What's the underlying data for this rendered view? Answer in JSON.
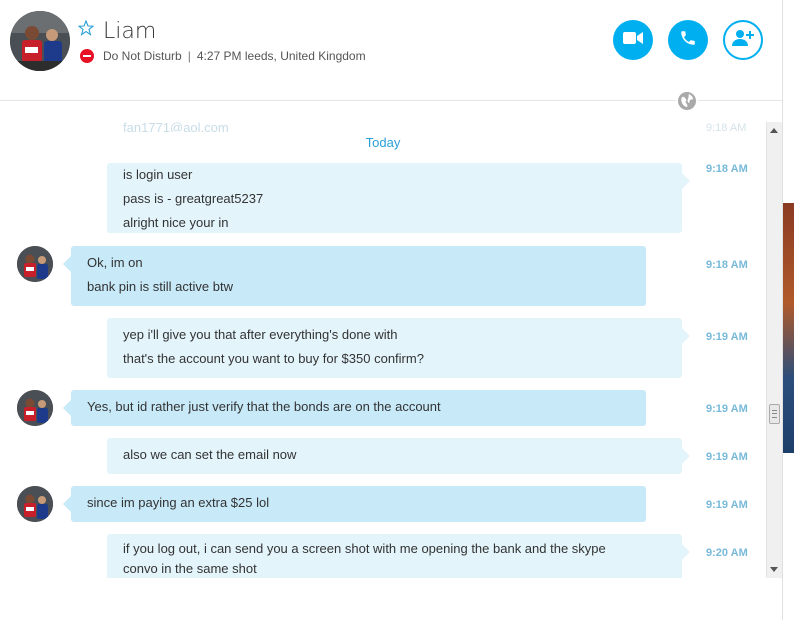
{
  "contact": {
    "name": "Liam",
    "status": "Do Not Disturb",
    "local_time": "4:27 PM leeds, United Kingdom",
    "separator": "|"
  },
  "icons": {
    "star": "star-outline-icon",
    "video": "video-camera-icon",
    "call": "phone-icon",
    "add_people": "add-person-icon",
    "globe": "globe-icon",
    "dnd": "do-not-disturb-icon"
  },
  "colors": {
    "accent": "#00aff0",
    "outgoing_bubble": "#e3f4fb",
    "incoming_bubble": "#c7e9f8",
    "dnd_red": "#e81123",
    "timestamp": "#77b9d8",
    "today": "#2a9fd6"
  },
  "conversation": {
    "faded_top": {
      "text": "fan1771@aol.com",
      "time": "9:18 AM"
    },
    "date_separator": "Today",
    "messages": [
      {
        "from": "me",
        "lines": [
          "is login user",
          "pass is - greatgreat5237",
          "alright nice your in"
        ],
        "time": "9:18 AM"
      },
      {
        "from": "contact",
        "lines": [
          "Ok, im on",
          "bank pin is still active btw"
        ],
        "time": "9:18 AM"
      },
      {
        "from": "me",
        "lines": [
          "yep i'll give you that after everything's done with",
          "that's the account you want to buy for $350 confirm?"
        ],
        "time": "9:19 AM"
      },
      {
        "from": "contact",
        "lines": [
          "Yes, but id rather just verify that the bonds are on the account"
        ],
        "time": "9:19 AM"
      },
      {
        "from": "me",
        "lines": [
          "also we can set the email now"
        ],
        "time": "9:19 AM"
      },
      {
        "from": "contact",
        "lines": [
          "since im paying an extra $25 lol"
        ],
        "time": "9:19 AM"
      },
      {
        "from": "me",
        "lines": [
          "if you log out, i can send you a screen shot with me opening the bank and the skype",
          "convo in the same shot"
        ],
        "time": "9:20 AM"
      }
    ]
  }
}
